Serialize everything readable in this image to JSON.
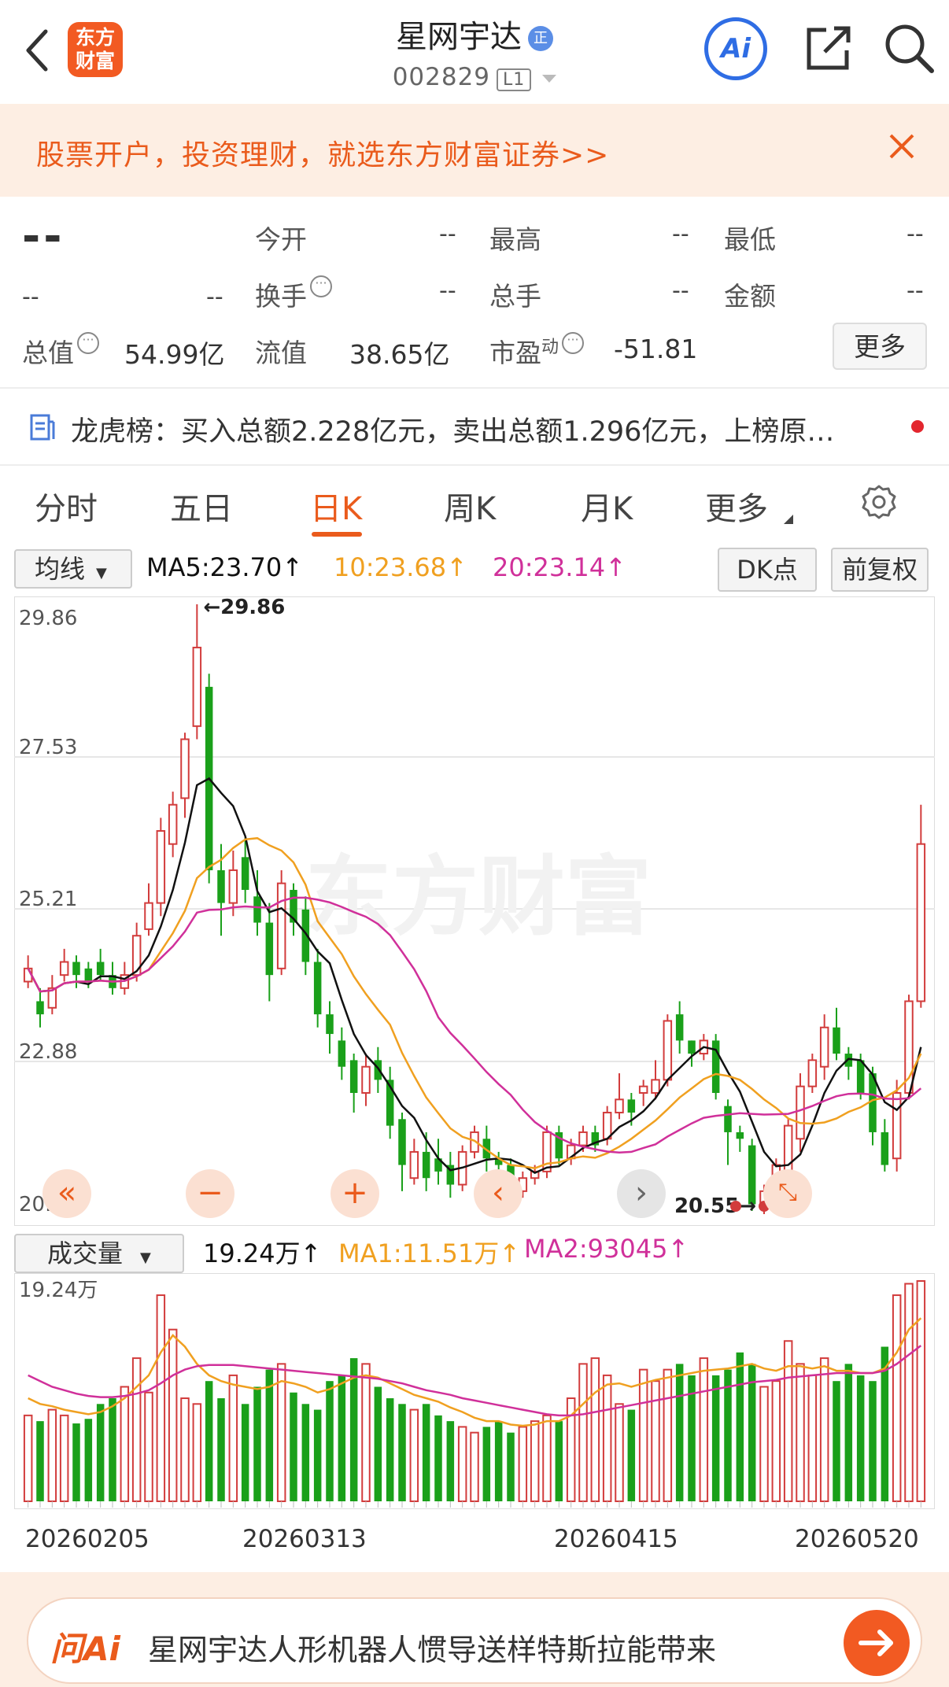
{
  "header": {
    "logo_line1": "东方",
    "logo_line2": "财富",
    "stock_name": "星网宇达",
    "badge": "正",
    "stock_code": "002829",
    "level": "L1",
    "ai_label": "Ai",
    "icons": [
      "back-arrow-icon",
      "share-icon",
      "search-icon"
    ]
  },
  "promo": {
    "text": "股票开户，投资理财，就选东方财富证券>>"
  },
  "quote": {
    "price": "--",
    "change": "--",
    "change_pct": "--",
    "open_label": "今开",
    "open_value": "--",
    "high_label": "最高",
    "high_value": "--",
    "low_label": "最低",
    "low_value": "--",
    "turnover_label": "换手",
    "turnover_value": "--",
    "volume_label": "总手",
    "volume_value": "--",
    "amount_label": "金额",
    "amount_value": "--",
    "mktcap_label": "总值",
    "mktcap_value": "54.99亿",
    "float_label": "流值",
    "float_value": "38.65亿",
    "pe_label": "市盈",
    "pe_sup": "动",
    "pe_value": "-51.81",
    "more_label": "更多"
  },
  "news": {
    "text": "龙虎榜：买入总额2.228亿元，卖出总额1.296亿元，上榜原…"
  },
  "tabs": {
    "items": [
      "分时",
      "五日",
      "日K",
      "周K",
      "月K",
      "更多"
    ],
    "active": "日K"
  },
  "chart_toolbar": {
    "indicator_select": "均线",
    "ma5": "MA5:23.70",
    "ma10": "10:23.68",
    "ma20": "20:23.14",
    "dk_label": "DK点",
    "adjust_label": "前复权"
  },
  "volume_toolbar": {
    "indicator_select": "成交量",
    "vol": "19.24万",
    "ma1": "MA1:11.51万",
    "ma2": "MA2:93045"
  },
  "colors": {
    "up": "#d23c3c",
    "down": "#1aa01a",
    "ma5": "#111111",
    "ma10": "#f0a020",
    "ma20": "#d0309a",
    "accent": "#ea5b1c"
  },
  "chart_data": [
    {
      "type": "candlestick",
      "title": "",
      "y_ticks": [
        "29.86",
        "27.53",
        "25.21",
        "22.88",
        "20.55"
      ],
      "ylim": [
        20.55,
        29.86
      ],
      "max_marker": "29.86",
      "min_marker": "20.55",
      "watermark": "东方财富",
      "candles": [
        [
          24.1,
          24.3,
          24.0,
          24.5
        ],
        [
          23.8,
          23.6,
          23.4,
          24.0
        ],
        [
          23.7,
          24.0,
          23.6,
          24.2
        ],
        [
          24.2,
          24.4,
          24.1,
          24.6
        ],
        [
          24.4,
          24.2,
          24.0,
          24.5
        ],
        [
          24.3,
          24.1,
          24.0,
          24.4
        ],
        [
          24.4,
          24.2,
          24.1,
          24.6
        ],
        [
          24.2,
          24.0,
          23.9,
          24.4
        ],
        [
          24.0,
          24.2,
          23.9,
          24.4
        ],
        [
          24.2,
          24.8,
          24.1,
          25.0
        ],
        [
          24.9,
          25.3,
          24.8,
          25.6
        ],
        [
          25.3,
          26.4,
          25.1,
          26.6
        ],
        [
          26.2,
          26.8,
          26.0,
          27.0
        ],
        [
          26.9,
          27.8,
          26.6,
          27.9
        ],
        [
          28.0,
          29.2,
          27.8,
          29.86
        ],
        [
          28.6,
          25.8,
          25.6,
          28.8
        ],
        [
          25.8,
          25.3,
          24.8,
          26.2
        ],
        [
          25.3,
          25.8,
          25.1,
          26.1
        ],
        [
          26.0,
          25.5,
          25.3,
          26.3
        ],
        [
          25.4,
          25.0,
          24.8,
          25.8
        ],
        [
          25.0,
          24.2,
          23.8,
          25.3
        ],
        [
          24.3,
          25.6,
          24.2,
          25.8
        ],
        [
          25.5,
          25.0,
          24.8,
          25.6
        ],
        [
          25.2,
          24.4,
          24.2,
          25.4
        ],
        [
          24.4,
          23.6,
          23.4,
          24.6
        ],
        [
          23.6,
          23.3,
          23.0,
          23.8
        ],
        [
          23.2,
          22.8,
          22.6,
          23.4
        ],
        [
          22.9,
          22.4,
          22.1,
          23.0
        ],
        [
          22.4,
          22.8,
          22.2,
          23.0
        ],
        [
          22.9,
          22.6,
          22.4,
          23.1
        ],
        [
          22.6,
          21.9,
          21.7,
          22.8
        ],
        [
          22.0,
          21.3,
          20.9,
          22.1
        ],
        [
          21.1,
          21.5,
          21.0,
          21.7
        ],
        [
          21.5,
          21.1,
          20.9,
          21.8
        ],
        [
          21.4,
          21.2,
          21.0,
          21.7
        ],
        [
          21.3,
          21.0,
          20.8,
          21.5
        ],
        [
          21.0,
          21.5,
          20.9,
          21.6
        ],
        [
          21.5,
          21.8,
          21.4,
          21.9
        ],
        [
          21.7,
          21.4,
          21.2,
          21.9
        ],
        [
          21.4,
          21.3,
          21.1,
          21.5
        ],
        [
          21.3,
          20.9,
          20.7,
          21.4
        ],
        [
          20.9,
          21.1,
          20.8,
          21.2
        ],
        [
          21.1,
          21.2,
          21.0,
          21.3
        ],
        [
          21.2,
          21.8,
          21.1,
          21.9
        ],
        [
          21.8,
          21.4,
          21.3,
          21.9
        ],
        [
          21.4,
          21.6,
          21.3,
          21.7
        ],
        [
          21.6,
          21.8,
          21.5,
          21.9
        ],
        [
          21.8,
          21.6,
          21.5,
          21.9
        ],
        [
          21.7,
          22.1,
          21.6,
          22.2
        ],
        [
          22.1,
          22.3,
          22.0,
          22.7
        ],
        [
          22.3,
          22.1,
          21.9,
          22.4
        ],
        [
          22.4,
          22.5,
          22.2,
          22.6
        ],
        [
          22.4,
          22.6,
          22.3,
          22.9
        ],
        [
          22.6,
          23.5,
          22.5,
          23.6
        ],
        [
          23.6,
          23.2,
          23.0,
          23.8
        ],
        [
          23.2,
          23.0,
          22.8,
          23.2
        ],
        [
          23.0,
          23.2,
          22.9,
          23.3
        ],
        [
          23.2,
          22.4,
          22.3,
          23.3
        ],
        [
          22.2,
          21.8,
          21.3,
          22.3
        ],
        [
          21.8,
          21.7,
          21.5,
          21.9
        ],
        [
          21.6,
          20.7,
          20.6,
          21.7
        ],
        [
          20.7,
          20.9,
          20.55,
          21.0
        ],
        [
          20.9,
          21.3,
          20.8,
          21.4
        ],
        [
          21.2,
          21.9,
          21.1,
          22.0
        ],
        [
          21.7,
          22.5,
          21.5,
          22.7
        ],
        [
          22.5,
          22.9,
          22.4,
          23.0
        ],
        [
          22.8,
          23.4,
          22.6,
          23.6
        ],
        [
          23.4,
          23.0,
          22.9,
          23.7
        ],
        [
          23.0,
          22.8,
          22.6,
          23.1
        ],
        [
          22.9,
          22.4,
          22.3,
          23.0
        ],
        [
          22.7,
          21.8,
          21.6,
          22.8
        ],
        [
          21.8,
          21.3,
          21.2,
          22.0
        ],
        [
          21.4,
          22.4,
          21.2,
          22.6
        ],
        [
          22.4,
          23.8,
          22.3,
          23.9
        ],
        [
          23.8,
          26.2,
          23.7,
          26.8
        ]
      ]
    },
    {
      "type": "bar",
      "title": "",
      "y_top_label": "19.24万",
      "x_ticks": [
        "20260205",
        "20260313",
        "20260415",
        "20260520"
      ],
      "values": [
        7.5,
        7.0,
        8.0,
        7.5,
        6.8,
        7.2,
        8.5,
        9.0,
        10.0,
        12.5,
        9.5,
        18.0,
        15.0,
        9.0,
        8.5,
        10.5,
        9.0,
        11.0,
        8.5,
        10.0,
        11.5,
        12.0,
        9.5,
        8.5,
        8.0,
        10.5,
        11.0,
        12.5,
        12.0,
        10.0,
        9.0,
        8.5,
        8.0,
        8.5,
        7.5,
        7.0,
        6.5,
        6.0,
        6.5,
        7.0,
        6.0,
        6.5,
        7.0,
        7.5,
        7.0,
        9.0,
        12.0,
        12.5,
        11.0,
        8.5,
        8.0,
        11.5,
        10.5,
        11.5,
        12.0,
        11.0,
        12.5,
        11.0,
        11.5,
        13.0,
        12.0,
        10.0,
        10.5,
        14.0,
        12.0,
        11.0,
        12.5,
        10.5,
        12.0,
        11.0,
        10.5,
        13.5,
        18.0,
        19.0,
        19.24
      ],
      "up": [
        1,
        0,
        1,
        1,
        0,
        0,
        0,
        0,
        1,
        1,
        1,
        1,
        1,
        1,
        1,
        0,
        0,
        1,
        0,
        0,
        0,
        1,
        0,
        0,
        0,
        0,
        0,
        0,
        1,
        0,
        0,
        0,
        1,
        0,
        0,
        0,
        1,
        1,
        0,
        0,
        0,
        1,
        1,
        1,
        0,
        1,
        1,
        1,
        1,
        1,
        0,
        1,
        1,
        1,
        0,
        0,
        1,
        0,
        0,
        0,
        0,
        1,
        1,
        1,
        1,
        1,
        1,
        0,
        0,
        0,
        0,
        0,
        1,
        1,
        1
      ],
      "series": [
        {
          "name": "MA1",
          "values": [
            9.0,
            8.5,
            8.3,
            8.0,
            7.8,
            7.6,
            7.8,
            8.3,
            9.0,
            10.0,
            11.0,
            13.0,
            14.5,
            13.5,
            12.0,
            11.0,
            10.5,
            10.2,
            10.0,
            9.8,
            10.0,
            10.5,
            10.3,
            10.0,
            9.5,
            9.8,
            10.3,
            10.8,
            11.0,
            10.8,
            10.3,
            9.8,
            9.3,
            9.0,
            8.7,
            8.2,
            7.8,
            7.3,
            7.0,
            7.0,
            6.7,
            6.6,
            6.7,
            7.0,
            7.0,
            7.5,
            8.5,
            9.5,
            10.2,
            10.3,
            10.0,
            10.3,
            10.6,
            10.8,
            11.0,
            11.2,
            11.4,
            11.5,
            11.6,
            11.8,
            12.0,
            11.6,
            11.4,
            11.8,
            11.8,
            11.6,
            11.8,
            11.4,
            11.4,
            11.2,
            11.2,
            11.6,
            13.0,
            15.0,
            16.0
          ]
        },
        {
          "name": "MA2",
          "values": [
            11.0,
            10.5,
            10.0,
            9.7,
            9.4,
            9.2,
            9.1,
            9.1,
            9.2,
            9.4,
            9.7,
            10.3,
            11.0,
            11.5,
            11.8,
            11.9,
            11.9,
            11.9,
            11.8,
            11.7,
            11.6,
            11.5,
            11.4,
            11.3,
            11.2,
            11.1,
            11.0,
            10.9,
            10.8,
            10.7,
            10.5,
            10.3,
            10.0,
            9.7,
            9.5,
            9.3,
            9.0,
            8.8,
            8.6,
            8.4,
            8.2,
            8.0,
            7.8,
            7.6,
            7.5,
            7.5,
            7.6,
            7.8,
            8.0,
            8.2,
            8.4,
            8.6,
            8.8,
            9.0,
            9.2,
            9.4,
            9.6,
            9.8,
            10.0,
            10.2,
            10.4,
            10.5,
            10.6,
            10.8,
            10.9,
            11.0,
            11.1,
            11.2,
            11.2,
            11.2,
            11.2,
            11.4,
            12.0,
            12.8,
            13.6
          ]
        }
      ]
    }
  ],
  "ask_bar": {
    "logo": "问Ai",
    "text": "星网宇达人形机器人惯导送样特斯拉能带来"
  }
}
